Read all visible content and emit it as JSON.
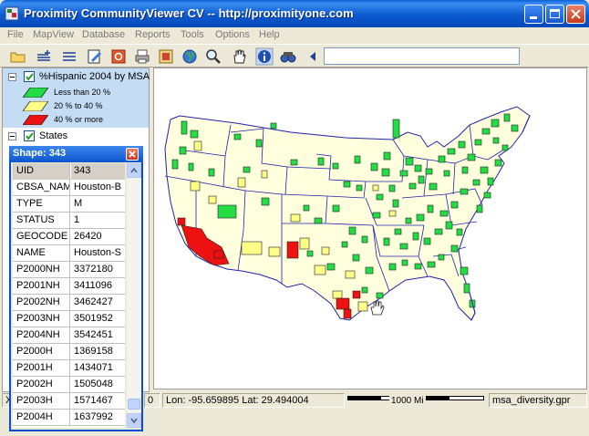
{
  "window": {
    "title": "Proximity CommunityViewer CV -- http://proximityone.com"
  },
  "menu": {
    "items": [
      "File",
      "MapView",
      "Database",
      "Reports",
      "Tools",
      "Options",
      "Help"
    ]
  },
  "toolbar": {
    "icons": [
      "open-folder-icon",
      "add-layer-icon",
      "layer-list-icon",
      "edit-icon",
      "stop-icon",
      "print-icon",
      "export-icon",
      "globe-icon",
      "zoom-icon",
      "pan-hand-icon",
      "info-icon",
      "find-icon",
      "back-arrow-icon"
    ],
    "input_value": ""
  },
  "legend": {
    "layers": [
      {
        "label": "%Hispanic 2004 by MSA",
        "checked": true
      },
      {
        "label": "States",
        "checked": true
      }
    ],
    "classes": [
      {
        "label": "Less than 20 %",
        "color": "#22dd44"
      },
      {
        "label": "20 % to 40 %",
        "color": "#ffff88"
      },
      {
        "label": "40 % or more",
        "color": "#ee1111"
      }
    ]
  },
  "popup": {
    "title": "Shape: 343",
    "rows": [
      {
        "key": "UID",
        "value": "343"
      },
      {
        "key": "CBSA_NAME",
        "value": "Houston-B"
      },
      {
        "key": "TYPE",
        "value": "M"
      },
      {
        "key": "STATUS",
        "value": "1"
      },
      {
        "key": "GEOCODE",
        "value": "26420"
      },
      {
        "key": "NAME",
        "value": "Houston-S"
      },
      {
        "key": "P2000NH",
        "value": "3372180"
      },
      {
        "key": "P2001NH",
        "value": "3411096"
      },
      {
        "key": "P2002NH",
        "value": "3462427"
      },
      {
        "key": "P2003NH",
        "value": "3501952"
      },
      {
        "key": "P2004NH",
        "value": "3542451"
      },
      {
        "key": "P2000H",
        "value": "1369158"
      },
      {
        "key": "P2001H",
        "value": "1434071"
      },
      {
        "key": "P2002H",
        "value": "1505048"
      },
      {
        "key": "P2003H",
        "value": "1571467"
      },
      {
        "key": "P2004H",
        "value": "1637992"
      }
    ]
  },
  "statusbar": {
    "left": "X",
    "zoom_tail": "0",
    "lon_label": "Lon:",
    "lon": "-95.659895",
    "lat_label": "Lat:",
    "lat": "29.494004",
    "scale_label": "1000 Mi",
    "file": "msa_diversity.gpr"
  },
  "colors": {
    "titlebar": "#0b5ad0",
    "state_fill": "#ffffdd",
    "state_border": "#2222aa",
    "low": "#22dd44",
    "mid": "#ffff88",
    "high": "#ee1111"
  }
}
